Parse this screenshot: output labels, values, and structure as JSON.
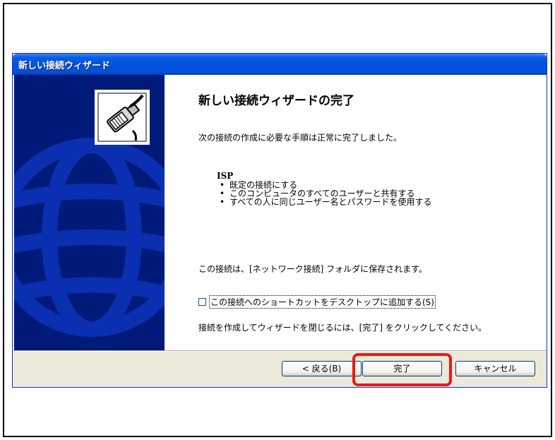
{
  "window": {
    "title": "新しい接続ウィザード"
  },
  "wizard": {
    "heading": "新しい接続ウィザードの完了",
    "intro": "次の接続の作成に必要な手順は正常に完了しました。",
    "connection_name": "ISP",
    "details": [
      "既定の接続にする",
      "このコンピュータのすべてのユーザーと共有する",
      "すべての人に同じユーザー名とパスワードを使用する"
    ],
    "save_note": "この接続は、[ネットワーク接続] フォルダに保存されます。",
    "shortcut_checkbox_label": "この接続へのショートカットをデスクトップに追加する(S)",
    "shortcut_checked": false,
    "closing_note": "接続を作成してウィザードを閉じるには、[完了] をクリックしてください。"
  },
  "buttons": {
    "back": "< 戻る(B)",
    "finish": "完了",
    "cancel": "キャンセル"
  },
  "colors": {
    "titlebar": "#0053e0",
    "side_panel": "#001a7a",
    "highlight": "#e41b17"
  },
  "icons": {
    "wizard_icon": "network-cable-icon",
    "side_decoration": "globe-graphic"
  }
}
